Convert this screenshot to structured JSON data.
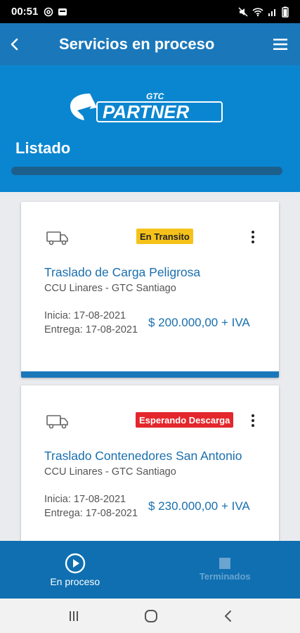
{
  "status_bar": {
    "time": "00:51"
  },
  "app_bar": {
    "title": "Servicios en proceso"
  },
  "header": {
    "logo_text_small": "GTC",
    "logo_text_big": "PARTNER",
    "list_title": "Listado"
  },
  "colors": {
    "primary": "#1a78ba",
    "header_bg": "#0a86d0",
    "badge_transit": "#f5c21b",
    "badge_waiting": "#e3272d"
  },
  "services": [
    {
      "status": "En Transito",
      "title": "Traslado de Carga Peligrosa",
      "route": "CCU Linares - GTC Santiago",
      "start": "Inicia: 17-08-2021",
      "delivery": "Entrega: 17-08-2021",
      "price": "$ 200.000,00 + IVA"
    },
    {
      "status": "Esperando Descarga",
      "title": "Traslado Contenedores San Antonio",
      "route": "CCU Linares - GTC Santiago",
      "start": "Inicia: 17-08-2021",
      "delivery": "Entrega: 17-08-2021",
      "price": "$ 230.000,00 + IVA"
    }
  ],
  "bottom_nav": [
    {
      "label": "En proceso",
      "icon": "play-circle-icon"
    },
    {
      "label": "Terminados",
      "icon": "stop-square-icon"
    }
  ]
}
